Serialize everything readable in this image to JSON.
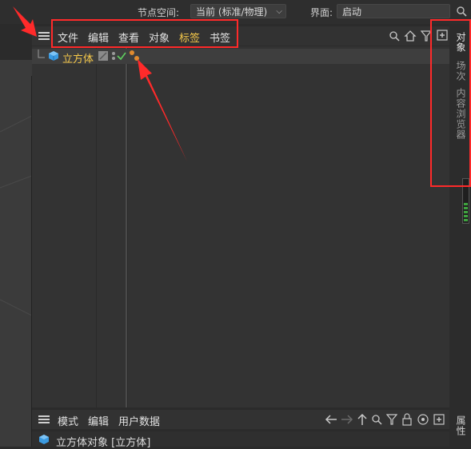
{
  "topbar": {
    "node_space_label": "节点空间:",
    "node_space_value": "当前 (标准/物理)",
    "layout_label": "界面:",
    "layout_value": "启动"
  },
  "object_manager": {
    "menu": [
      "文件",
      "编辑",
      "查看",
      "对象",
      "标签",
      "书签"
    ],
    "active_menu_index": 4,
    "object_name": "立方体"
  },
  "right_tabs": [
    "对象",
    "场次",
    "内容浏览器"
  ],
  "attribute_manager": {
    "menu": [
      "模式",
      "编辑",
      "用户数据"
    ],
    "title": "立方体对象 [立方体]",
    "side_tab": "属性"
  },
  "colors": {
    "accent_active": "#f5c84a",
    "annotation_red": "#ff2a2a",
    "cube_blue": "#3b9ae0"
  }
}
